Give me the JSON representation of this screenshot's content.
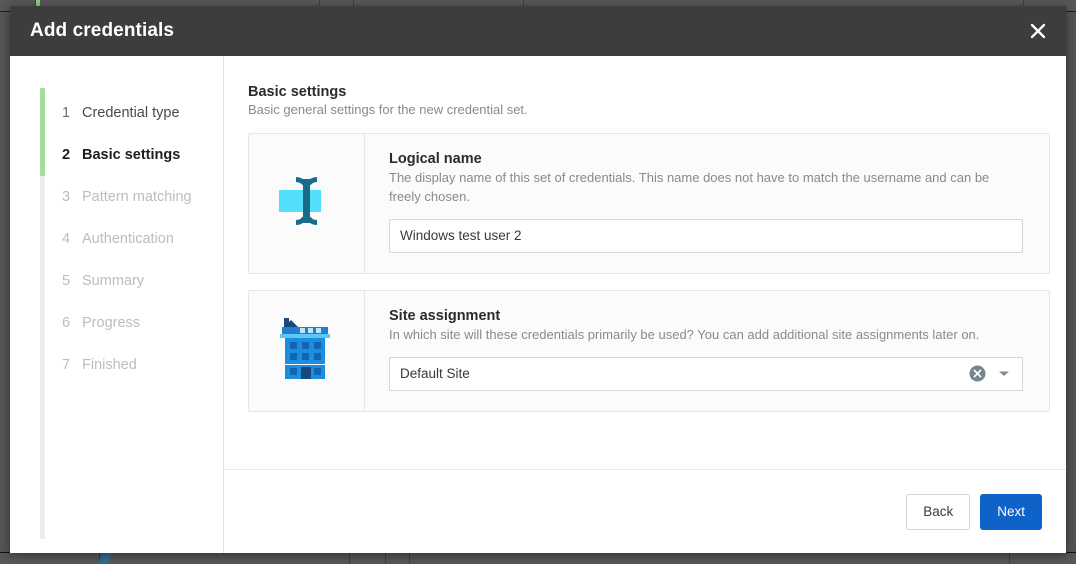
{
  "window": {
    "title": "Add credentials",
    "close_icon": "close-icon"
  },
  "sidebar": {
    "steps": [
      {
        "num": "1",
        "label": "Credential type",
        "state": "done"
      },
      {
        "num": "2",
        "label": "Basic settings",
        "state": "active"
      },
      {
        "num": "3",
        "label": "Pattern matching",
        "state": "disabled"
      },
      {
        "num": "4",
        "label": "Authentication",
        "state": "disabled"
      },
      {
        "num": "5",
        "label": "Summary",
        "state": "disabled"
      },
      {
        "num": "6",
        "label": "Progress",
        "state": "disabled"
      },
      {
        "num": "7",
        "label": "Finished",
        "state": "disabled"
      }
    ],
    "progress_color": "#a5dca0",
    "rail_color": "#ececec"
  },
  "main": {
    "section_title": "Basic settings",
    "section_subtitle": "Basic general settings for the new credential set.",
    "cards": [
      {
        "icon": "text-cursor-icon",
        "title": "Logical name",
        "description": "The display name of this set of credentials. This name does not have to match the username and can be freely chosen.",
        "input_value": "Windows test user 2",
        "input_placeholder": "Logical name"
      },
      {
        "icon": "office-building-icon",
        "title": "Site assignment",
        "description": "In which site will these credentials primarily be used? You can add additional site assignments later on.",
        "select_value": "Default Site",
        "clear_icon": "clear-circle-icon",
        "caret_icon": "chevron-down-icon"
      }
    ]
  },
  "footer": {
    "back_label": "Back",
    "next_label": "Next",
    "primary_color": "#0f62c8"
  },
  "colors": {
    "titlebar": "#3d3d3d",
    "icon_cyan": "#53dffb",
    "icon_teal": "#1a6b8a",
    "icon_blue": "#1a8fe0",
    "icon_blue_dark": "#1464b4"
  }
}
